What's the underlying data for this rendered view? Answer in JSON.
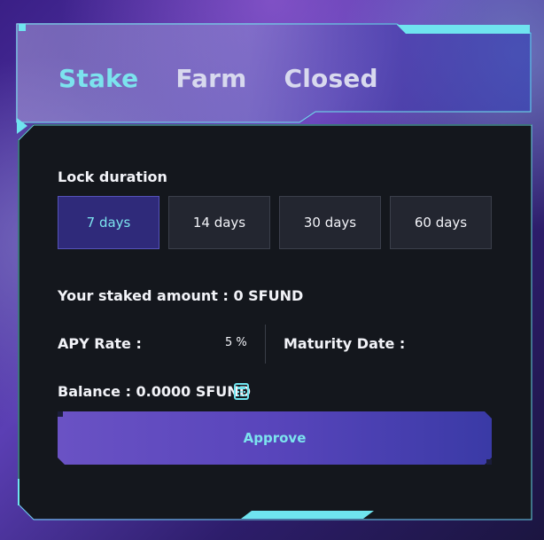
{
  "tabs": [
    {
      "label": "Stake",
      "active": true
    },
    {
      "label": "Farm",
      "active": false
    },
    {
      "label": "Closed",
      "active": false
    }
  ],
  "lock": {
    "title": "Lock duration",
    "options": [
      {
        "label": "7 days",
        "selected": true
      },
      {
        "label": "14 days",
        "selected": false
      },
      {
        "label": "30 days",
        "selected": false
      },
      {
        "label": "60 days",
        "selected": false
      }
    ]
  },
  "staked_label": "Your staked amount : 0 SFUND",
  "apy": {
    "label": "APY Rate :",
    "value": "5 %"
  },
  "maturity_label": "Maturity Date :",
  "balance_label": "Balance : 0.0000 SFUND",
  "approve_label": "Approve",
  "colors": {
    "accent": "#7ce3ee",
    "card": "#14171d",
    "button": "#5845bb"
  }
}
